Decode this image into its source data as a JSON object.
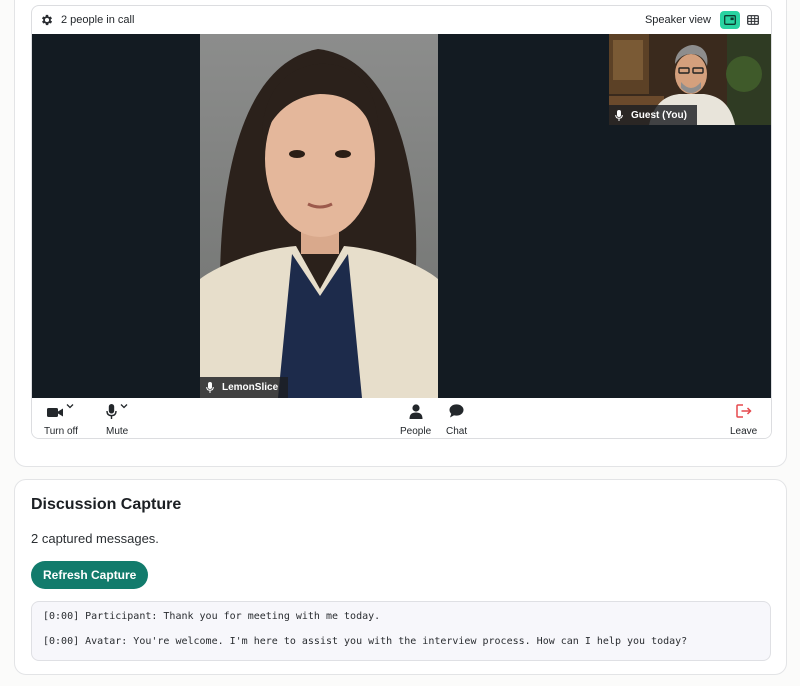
{
  "call": {
    "participants_label": "2 people in call",
    "view_label": "Speaker view",
    "main_participant_name": "LemonSlice",
    "self_participant_name": "Guest (You)",
    "controls": {
      "camera_label": "Turn off",
      "mic_label": "Mute",
      "people_label": "People",
      "chat_label": "Chat",
      "leave_label": "Leave"
    },
    "colors": {
      "active_view": "#2ad3a1",
      "leave": "#e5484d",
      "stage": "#131b22"
    }
  },
  "capture": {
    "title": "Discussion Capture",
    "count_text": "2 captured messages.",
    "refresh_label": "Refresh Capture",
    "messages": [
      "[0:00] Participant: Thank you for meeting with me today.",
      "[0:00] Avatar: You're welcome. I'm here to assist you with the interview process. How can I help you today?"
    ],
    "colors": {
      "refresh_button": "#127b6c"
    }
  }
}
